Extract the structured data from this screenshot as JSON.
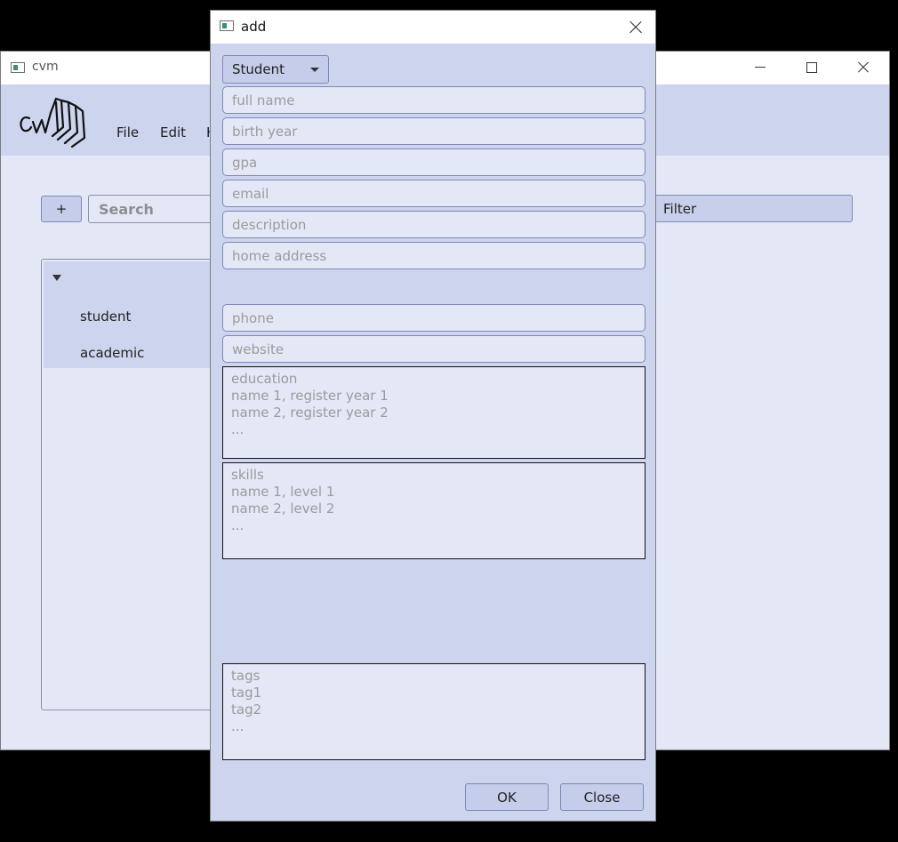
{
  "main_window": {
    "title": "cvm",
    "menu": {
      "file": "File",
      "edit": "Edit",
      "help_partial": "H"
    },
    "add_label": "+",
    "search_placeholder": "Search",
    "filter_label": "Filter",
    "tree": {
      "items": [
        "student",
        "academic"
      ]
    }
  },
  "dialog": {
    "title": "add",
    "type_select": {
      "selected": "Student"
    },
    "fields": {
      "full_name": "full name",
      "birth_year": "birth year",
      "gpa": "gpa",
      "email": "email",
      "description": "description",
      "home_address": "home address",
      "phone": "phone",
      "website": "website"
    },
    "textareas": {
      "education": "education\nname 1, register year 1\nname 2, register year 2\n...",
      "skills": "skills\nname 1, level 1\nname 2, level 2\n...",
      "tags": "tags\ntag1\ntag2\n..."
    },
    "buttons": {
      "ok": "OK",
      "close": "Close"
    }
  },
  "icons": [
    "app-icon",
    "minimize-icon",
    "maximize-icon",
    "close-icon",
    "dropdown-caret-icon",
    "tree-expand-icon"
  ],
  "colors": {
    "panel": "#cdd4ed",
    "input_bg": "#e4e8f6",
    "button": "#c6cdea",
    "border": "#7e88b8",
    "desktop": "#000000"
  }
}
